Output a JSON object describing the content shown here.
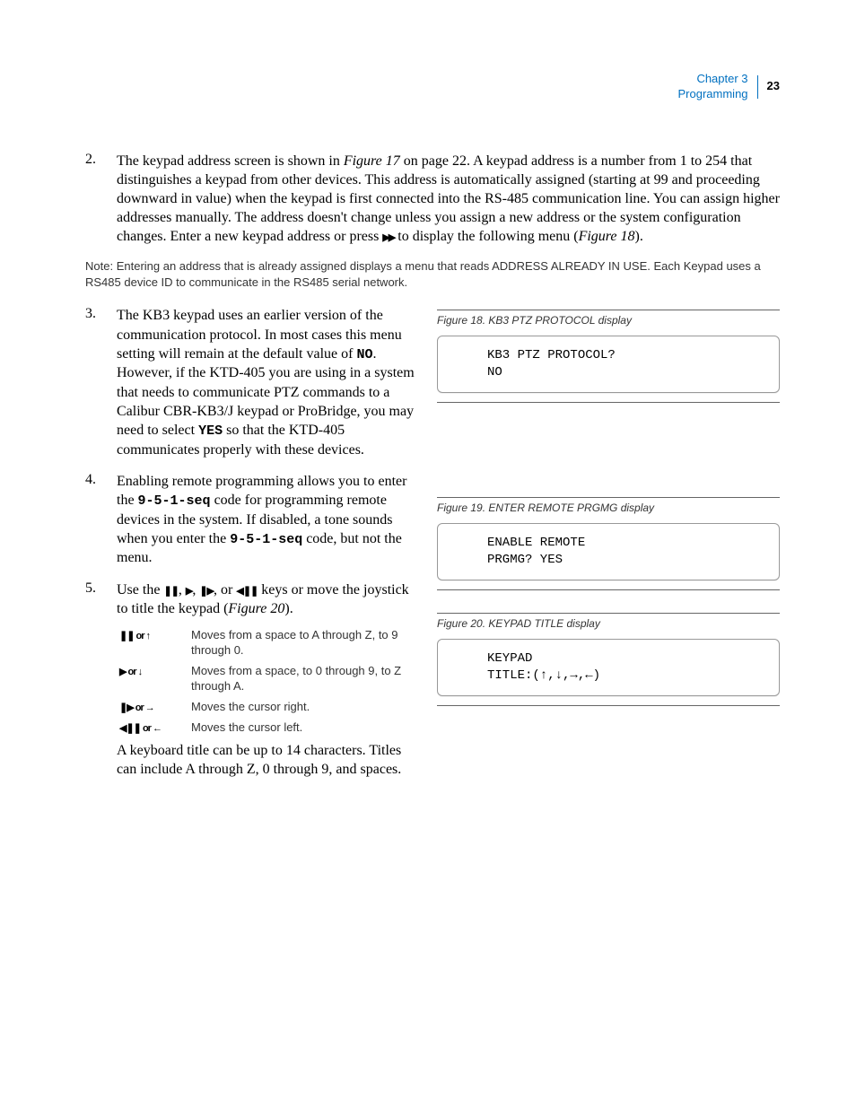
{
  "header": {
    "chapter": "Chapter 3",
    "section": "Programming",
    "page": "23"
  },
  "item2": {
    "num": "2.",
    "text_a": "The keypad address screen is shown in ",
    "fig17": "Figure 17",
    "text_b": " on page 22. A keypad address is a number from 1 to 254 that distinguishes a keypad from other devices. This address is automatically assigned (starting at 99 and proceeding downward in value) when the keypad is first connected into the RS-485 communication line. You can assign higher addresses manually. The address doesn't change unless you assign a new address or the system configuration changes. Enter a new keypad address or press ",
    "text_c": " to display the following menu (",
    "fig18": "Figure 18",
    "text_d": ")."
  },
  "note": {
    "label": "Note:",
    "text": "Entering an address that is already assigned displays a menu that reads ADDRESS ALREADY IN USE. Each Keypad uses a RS485 device ID to communicate in the RS485 serial network."
  },
  "item3": {
    "num": "3.",
    "text_a": "The KB3 keypad uses an earlier version of the communication protocol. In most cases this menu setting will remain at the default value of ",
    "no": "NO",
    "text_b": ". However, if the KTD-405 you are using in a system that needs to communicate PTZ commands to a Calibur CBR-KB3/J keypad or ProBridge, you may need to select ",
    "yes": "YES",
    "text_c": " so that the KTD-405 communicates properly with these devices."
  },
  "item4": {
    "num": "4.",
    "text_a": "Enabling remote programming allows you to enter the ",
    "code": "9-5-1-seq",
    "text_b": " code for programming remote devices in the system. If disabled, a tone sounds when you enter the ",
    "text_c": " code, but not the menu."
  },
  "item5": {
    "num": "5.",
    "text_a": "Use the ",
    "text_b": " keys or move the joystick to title the keypad (",
    "fig20": "Figure 20",
    "text_c": ")."
  },
  "keytable": {
    "r1_sym": "❚❚  or ↑",
    "r1_desc": "Moves from a space to A through Z, to 9 through 0.",
    "r2_sym": "▶  or ↓",
    "r2_desc": "Moves from a space, to 0 through 9, to Z through A.",
    "r3_sym": "❚▶   or  →",
    "r3_desc": "Moves the cursor right.",
    "r4_sym": "◀❚❚  or  ←",
    "r4_desc": "Moves the cursor left."
  },
  "item5_tail": "A keyboard title can be up to 14  characters. Titles can include A through Z, 0 through 9, and spaces.",
  "fig18": {
    "caption": "Figure 18.  KB3 PTZ PROTOCOL display",
    "line1": "KB3 PTZ PROTOCOL?",
    "line2": "NO"
  },
  "fig19": {
    "caption": "Figure 19.  ENTER REMOTE PRGMG display",
    "line1": "ENABLE REMOTE",
    "line2": "PRGMG? YES"
  },
  "fig20": {
    "caption": "Figure 20.  KEYPAD TITLE  display",
    "line1": "KEYPAD",
    "line2": "TITLE:(↑,↓,→,←)"
  },
  "glyphs": {
    "ff": "▶▶",
    "pause": "❚❚",
    "play": "▶",
    "stepf": "❚▶",
    "stepb": "◀❚❚",
    "comma": ", ",
    "or": ", or "
  }
}
